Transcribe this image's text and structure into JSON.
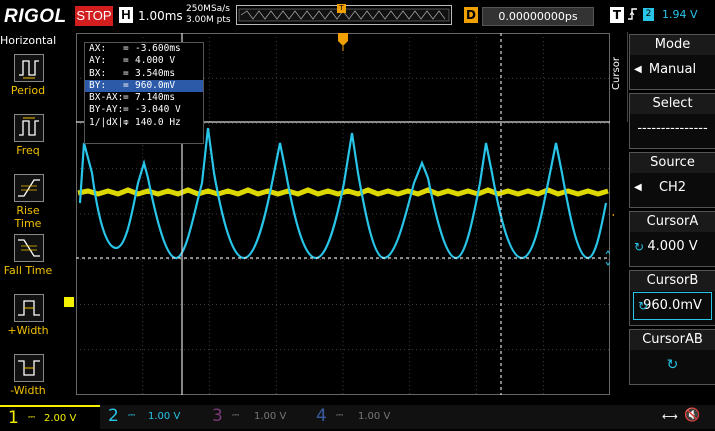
{
  "colors": {
    "ch1": "#f4f000",
    "ch2": "#29c5e8",
    "ch3": "#c040c0",
    "ch4": "#3a6ad8",
    "trigger": "#f0a000",
    "stop": "#d21e1e"
  },
  "header": {
    "logo": "RIGOL",
    "run_state": "STOP",
    "timebase_label": "H",
    "timebase_value": "1.00ms",
    "sample_rate": "250MSa/s",
    "memory_depth": "3.00M pts",
    "delay_label": "D",
    "delay_value": "0.00000000ps",
    "trigger_label": "T",
    "trigger_edge_icon": "rising-edge-icon",
    "trigger_source": "2",
    "trigger_level": "1.94 V"
  },
  "left_menu": {
    "title": "Horizontal",
    "items": [
      {
        "label": "Period",
        "icon": "period-measure-icon"
      },
      {
        "label": "Freq",
        "icon": "freq-measure-icon"
      },
      {
        "label": "Rise Time",
        "icon": "rise-time-icon"
      },
      {
        "label": "Fall Time",
        "icon": "fall-time-icon"
      },
      {
        "label": "+Width",
        "icon": "positive-width-icon"
      },
      {
        "label": "-Width",
        "icon": "negative-width-icon"
      }
    ]
  },
  "cursor_readout": {
    "rows": [
      {
        "key": "AX:",
        "value": "-3.600ms",
        "selected": false
      },
      {
        "key": "AY:",
        "value": "4.000 V",
        "selected": false
      },
      {
        "key": "BX:",
        "value": "3.540ms",
        "selected": false
      },
      {
        "key": "BY:",
        "value": "960.0mV",
        "selected": true
      },
      {
        "key": "BX-AX:",
        "value": "7.140ms",
        "selected": false
      },
      {
        "key": "BY-AY:",
        "value": "-3.040 V",
        "selected": false
      },
      {
        "key": "1/|dX|:",
        "value": "140.0 Hz",
        "selected": false
      }
    ],
    "eq": "="
  },
  "right_menu": {
    "side_title": "Cursor",
    "mode_label": "Mode",
    "mode_value": "Manual",
    "select_label": "Select",
    "select_value": "---------------",
    "source_label": "Source",
    "source_value": "CH2",
    "cursor_a_label": "CursorA",
    "cursor_a_value": "4.000 V",
    "cursor_b_label": "CursorB",
    "cursor_b_value": "960.0mV",
    "cursor_ab_label": "CursorAB"
  },
  "channels": [
    {
      "num": "1",
      "scale": "2.00 V",
      "active": true
    },
    {
      "num": "2",
      "scale": "1.00 V",
      "active": true
    },
    {
      "num": "3",
      "scale": "1.00 V",
      "active": false
    },
    {
      "num": "4",
      "scale": "1.00 V",
      "active": false
    }
  ],
  "status_icons": [
    "speaker-icon",
    "usb-icon"
  ]
}
